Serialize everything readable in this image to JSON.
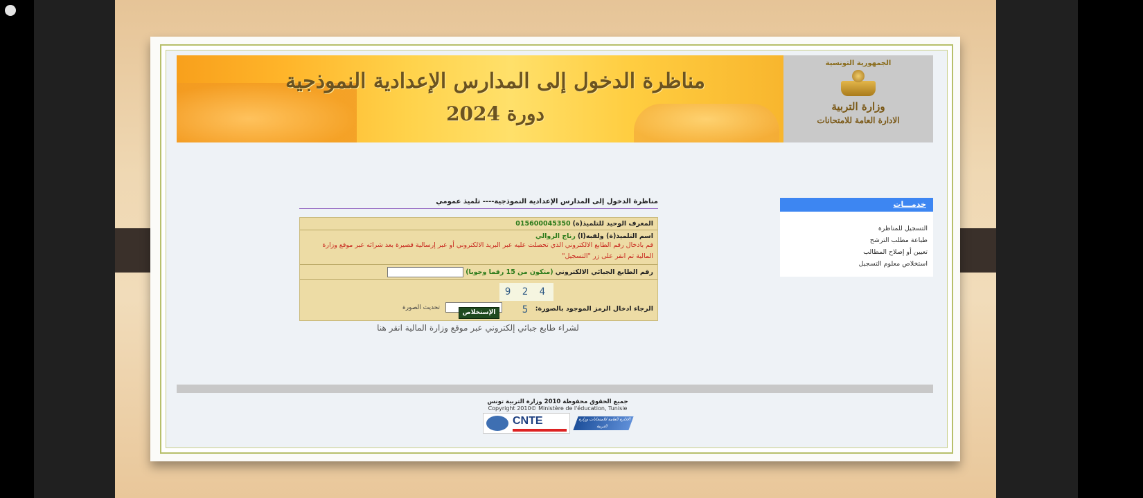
{
  "banner": {
    "title": "مناظرة الدخول إلى المدارس الإعدادية النموذجية",
    "session": "دورة 2024",
    "republic": "الجمهورية التونسية",
    "ministry": "وزارة التربية",
    "directorate": "الادارة العامة للامتحانات"
  },
  "sidebar": {
    "header": "خدمـــات",
    "items": [
      {
        "label": "التسجيل للمناظرة"
      },
      {
        "label": "طباعة مطلب الترشح"
      },
      {
        "label": "تعيين أو إصلاح المطالب"
      },
      {
        "label": "استخلاص معلوم التسجيل"
      }
    ]
  },
  "main": {
    "heading": "مناظرة الدخول إلى المدارس الإعدادية النموذجية---- تلميذ عمومي",
    "form": {
      "id_label": "المعرف الوحيد للتلميذ(ة)",
      "id_value": "015600045350",
      "name_label": "اسم التلميذ(ة) ولقبه(ا)",
      "name_value": "رناج الزوالي",
      "note": "قم بادخال رقم الطابع الالكتروني الذي تحصلت عليه عبر البريد الالكتروني أو عبر إرسالية قصيرة بعد شرائه عبر موقع وزارة المالية ثم انقر على زر \"التسجيل\"",
      "stamp_label": "رقم الطابع الجبائي الالكتروني",
      "stamp_hint": "(متكون من 15 رقما وجوبا)",
      "stamp_value": "",
      "captcha_text": "4 2 9 5",
      "captcha_label": "الرجاء ادخال الرمز الموجود بالصورة:",
      "captcha_value": "",
      "captcha_refresh": "تحديث الصورة"
    },
    "submit_label": "الإستخلاص",
    "buy_link": "لشراء طابع جبائي إلكتروني عبر موقع وزارة المالية انقر هنا"
  },
  "footer": {
    "copyright_ar": "جميع الحقوق محفوظة 2010 وزارة التربية تونس",
    "copyright_fr": "Copyright 2010© Ministère de l'éducation, Tunisie",
    "cnte": "CNTE",
    "direction_logo": "الادارة العامة للامتحانات وزارة التربية"
  }
}
